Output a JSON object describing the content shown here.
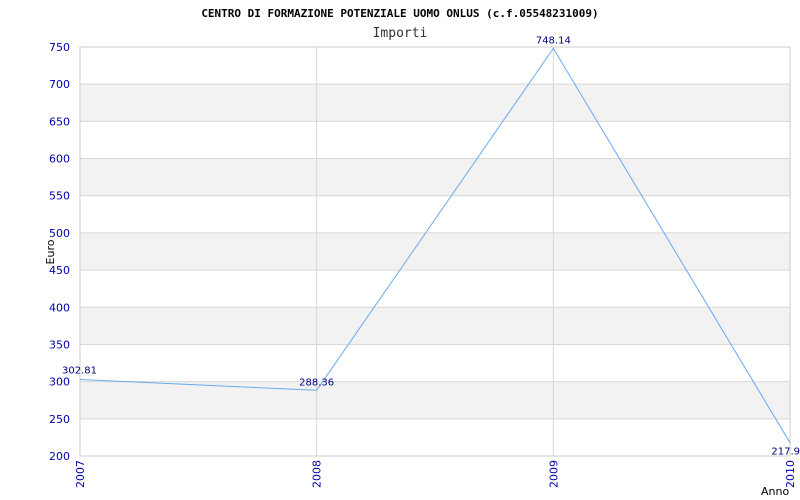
{
  "chart_data": {
    "type": "line",
    "title": "CENTRO DI FORMAZIONE POTENZIALE UOMO ONLUS (c.f.05548231009)",
    "subtitle": "Importi",
    "xlabel": "Anno",
    "ylabel": "Euro",
    "categories": [
      "2007",
      "2008",
      "2009",
      "2010"
    ],
    "series": [
      {
        "values": [
          302.81,
          288.36,
          748.14,
          217.9
        ],
        "labels": [
          "302.81",
          "288.36",
          "748.14",
          "217.9"
        ]
      }
    ],
    "ylim": [
      200,
      750
    ],
    "yticks": [
      200,
      250,
      300,
      350,
      400,
      450,
      500,
      550,
      600,
      650,
      700,
      750
    ],
    "grid": true,
    "colors": {
      "line": "#66aaee",
      "band": "#f2f2f2",
      "grid": "#d8d8d8",
      "tick_text": "#0000aa",
      "label_text": "#000080"
    }
  }
}
